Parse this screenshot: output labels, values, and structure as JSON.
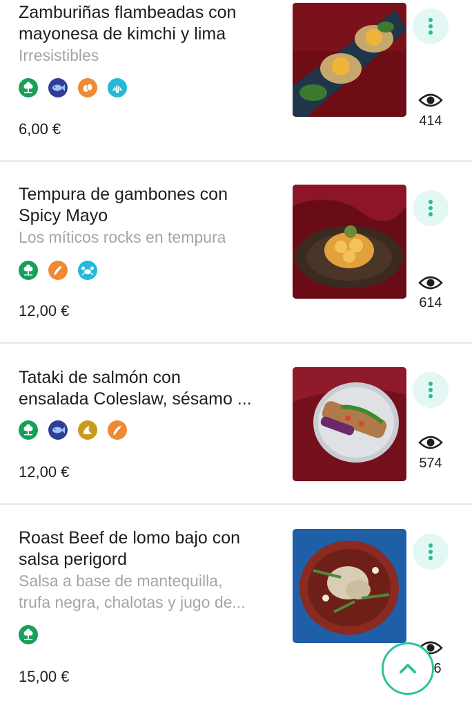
{
  "colors": {
    "accent": "#2cc39b",
    "accent_soft": "#e3f8f3",
    "muted_text": "#a5a5a5",
    "divider": "#e6e6e6",
    "allergen_green": "#16a05a",
    "allergen_navy": "#2e3f95",
    "allergen_orange": "#ef8a32",
    "allergen_cyan": "#25b8d8",
    "allergen_mustard": "#c99a1e"
  },
  "dishes": [
    {
      "title": "Zamburiñas flambeadas con\nmayonesa de kimchi y lima",
      "description": "Irresistibles",
      "allergens": [
        "vegetarian-icon",
        "fish-icon",
        "egg-icon",
        "shellfish-icon"
      ],
      "price": "6,00 €",
      "views": "414"
    },
    {
      "title": "Tempura de gambones con\nSpicy Mayo",
      "description": "Los míticos rocks en tempura",
      "allergens": [
        "vegetarian-icon",
        "gluten-icon",
        "crustacean-icon"
      ],
      "price": "12,00 €",
      "views": "614"
    },
    {
      "title": "Tataki de salmón con\nensalada Coleslaw, sésamo ...",
      "description": "",
      "allergens": [
        "vegetarian-icon",
        "fish-icon",
        "mustard-icon",
        "gluten-icon"
      ],
      "price": "12,00 €",
      "views": "574"
    },
    {
      "title": "Roast Beef de lomo bajo con\nsalsa perigord",
      "description": "Salsa a base de mantequilla,\ntrufa negra, chalotas y jugo de...",
      "allergens": [
        "vegetarian-icon"
      ],
      "price": "15,00 €",
      "views": "6"
    }
  ],
  "fab": {
    "icon": "chevron-up-icon"
  }
}
